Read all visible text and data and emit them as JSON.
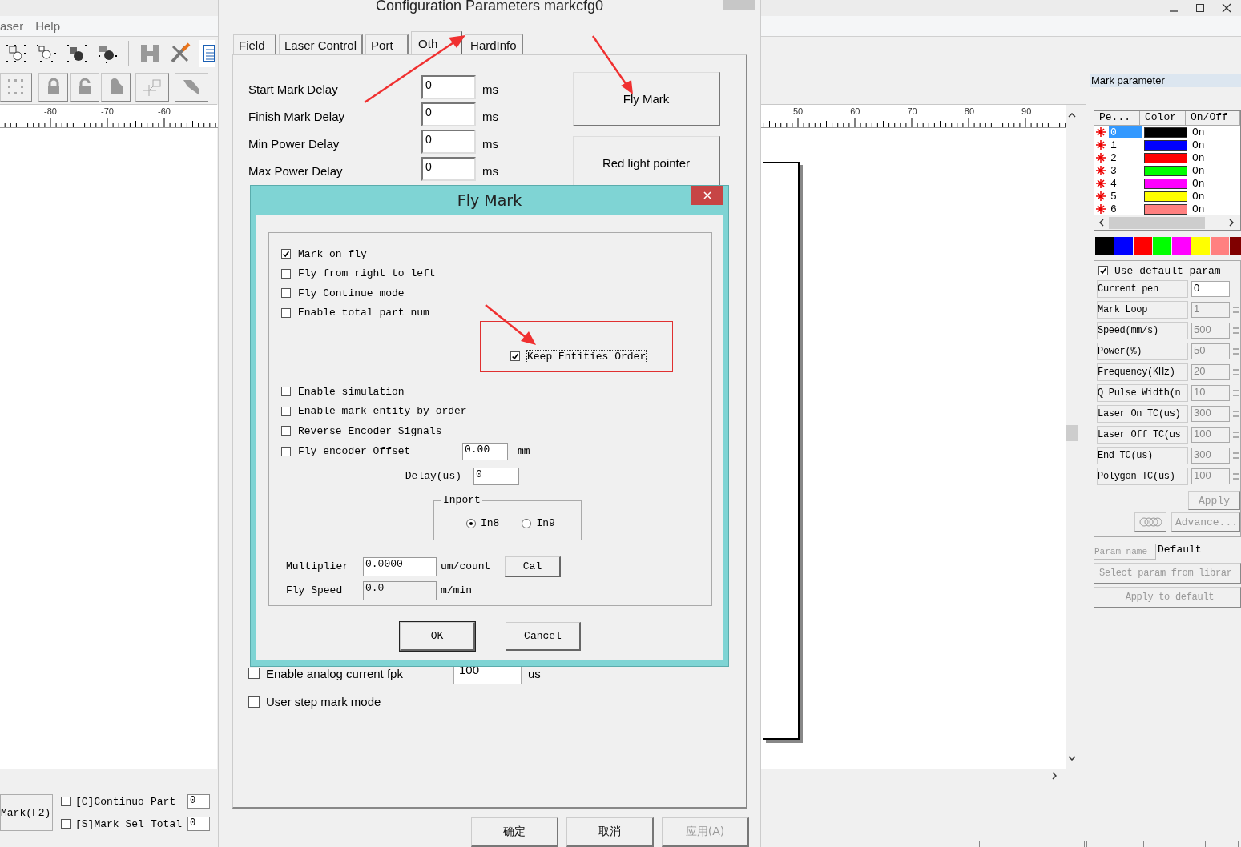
{
  "app": {
    "menu": [
      {
        "label": "aser"
      },
      {
        "label": "Help"
      }
    ],
    "left_ruler": {
      "labels": [
        "-80",
        "-70",
        "-60"
      ]
    },
    "right_ruler": {
      "labels": [
        "50",
        "60",
        "70",
        "80",
        "90"
      ]
    },
    "mark_button": "Mark(F2)",
    "mark_options": [
      {
        "label": "[C]Continuo",
        "checked": false,
        "field_label": "Part",
        "value": "0"
      },
      {
        "label": "[S]Mark Sel",
        "checked": false,
        "field_label": "Total",
        "value": "0"
      }
    ]
  },
  "mark_parameter": {
    "title": "Mark parameter",
    "columns": [
      "Pe...",
      "Color",
      "On/Off"
    ],
    "pens": [
      {
        "number": "0",
        "color": "#000000",
        "status": "On",
        "selected": true
      },
      {
        "number": "1",
        "color": "#0000ff",
        "status": "On",
        "selected": false
      },
      {
        "number": "2",
        "color": "#ff0000",
        "status": "On",
        "selected": false
      },
      {
        "number": "3",
        "color": "#00ff00",
        "status": "On",
        "selected": false
      },
      {
        "number": "4",
        "color": "#ff00ff",
        "status": "On",
        "selected": false
      },
      {
        "number": "5",
        "color": "#ffff00",
        "status": "On",
        "selected": false
      },
      {
        "number": "6",
        "color": "#ff8080",
        "status": "On",
        "selected": false
      }
    ],
    "swatches": [
      {
        "color": "#000000"
      },
      {
        "color": "#0000ff"
      },
      {
        "color": "#ff0000"
      },
      {
        "color": "#00ff00"
      },
      {
        "color": "#ff00ff"
      },
      {
        "color": "#ffff00"
      },
      {
        "color": "#ff8080"
      },
      {
        "color": "#800000"
      }
    ],
    "use_default": {
      "label": "Use default param",
      "checked": true
    },
    "params": [
      {
        "label": "Current pen",
        "value": "0",
        "disabled": false
      },
      {
        "label": "Mark Loop",
        "value": "1",
        "disabled": true
      },
      {
        "label": "Speed(mm/s)",
        "value": "500",
        "disabled": true
      },
      {
        "label": "Power(%)",
        "value": "50",
        "disabled": true
      },
      {
        "label": "Frequency(KHz)",
        "value": "20",
        "disabled": true
      },
      {
        "label": "Q Pulse Width(n",
        "value": "10",
        "disabled": true
      },
      {
        "label": "Laser On TC(us)",
        "value": "300",
        "disabled": true
      },
      {
        "label": "Laser Off TC(us",
        "value": "100",
        "disabled": true
      },
      {
        "label": "End TC(us)",
        "value": "300",
        "disabled": true
      },
      {
        "label": "Polygon TC(us)",
        "value": "100",
        "disabled": true
      }
    ],
    "apply": "Apply",
    "advance": "Advance...",
    "param_name": {
      "label": "Param name",
      "value": "Default"
    },
    "select_library": "Select param from librar",
    "apply_default": "Apply to default"
  },
  "config": {
    "title": "Configuration Parameters markcfg0",
    "tabs": [
      {
        "label": "Field",
        "selected": false
      },
      {
        "label": "Laser Control",
        "selected": false
      },
      {
        "label": "Port",
        "selected": false
      },
      {
        "label": "Oth",
        "selected": true
      },
      {
        "label": "HardInfo",
        "selected": false
      }
    ],
    "delays": [
      {
        "label": "Start Mark Delay",
        "value": "0",
        "unit": "ms"
      },
      {
        "label": "Finish Mark Delay",
        "value": "0",
        "unit": "ms"
      },
      {
        "label": "Min Power Delay",
        "value": "0",
        "unit": "ms"
      },
      {
        "label": "Max Power Delay",
        "value": "0",
        "unit": "ms"
      }
    ],
    "side_buttons": [
      "Fly Mark",
      "Red light pointer"
    ],
    "analog": {
      "label": "Enable analog current fpk",
      "checked": false,
      "value": "100",
      "unit": "us"
    },
    "user_step": {
      "label": "User step mark mode",
      "checked": false
    },
    "footer": [
      {
        "label": "确定",
        "disabled": false
      },
      {
        "label": "取消",
        "disabled": false
      },
      {
        "label": "应用(A)",
        "disabled": true
      }
    ]
  },
  "fly_mark": {
    "title": "Fly Mark",
    "options": [
      {
        "label": "Mark on fly",
        "checked": true
      },
      {
        "label": "Fly from right to left",
        "checked": false
      },
      {
        "label": "Fly Continue mode",
        "checked": false
      },
      {
        "label": "Enable total part num",
        "checked": false
      }
    ],
    "keep_order": {
      "label": "Keep Entities Order",
      "checked": true
    },
    "options2": [
      {
        "label": "Enable simulation",
        "checked": false
      },
      {
        "label": "Enable mark entity by order",
        "checked": false
      },
      {
        "label": "Reverse Encoder Signals",
        "checked": false
      }
    ],
    "encoder_offset": {
      "label": "Fly encoder Offset",
      "checked": false,
      "value": "0.00",
      "unit": "mm"
    },
    "delay": {
      "label": "Delay(us)",
      "value": "0"
    },
    "inport": {
      "title": "Inport",
      "options": [
        {
          "label": "In8",
          "selected": true
        },
        {
          "label": "In9",
          "selected": false
        }
      ]
    },
    "multiplier": {
      "label": "Multiplier",
      "value": "0.0000",
      "unit": "um/count",
      "disabled": false
    },
    "cal": "Cal",
    "fly_speed": {
      "label": "Fly Speed",
      "value": "0.0",
      "unit": "m/min",
      "disabled": true
    },
    "buttons": [
      "OK",
      "Cancel"
    ]
  }
}
